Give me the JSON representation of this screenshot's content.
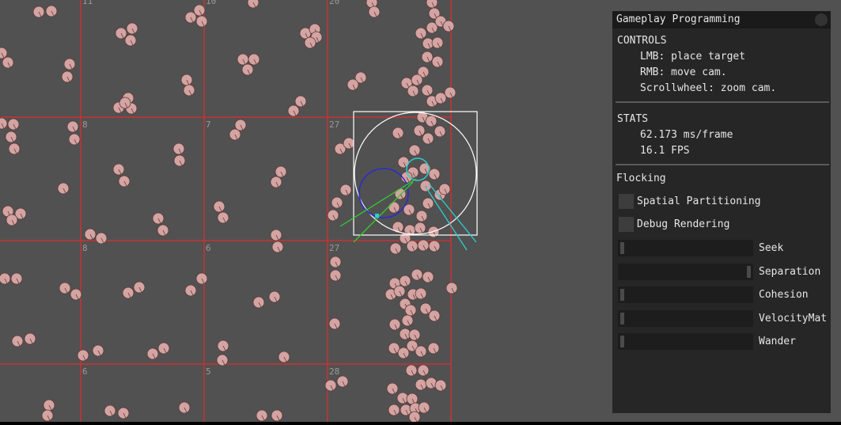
{
  "window": {
    "title": "Gameplay Programming"
  },
  "controls": {
    "header": "CONTROLS",
    "items": [
      "LMB: place target",
      "RMB: move cam.",
      "Scrollwheel: zoom cam."
    ]
  },
  "stats": {
    "header": "STATS",
    "frame_time": "62.173 ms/frame",
    "fps": "16.1 FPS"
  },
  "flocking": {
    "header": "Flocking",
    "toggles": [
      {
        "label": "Spatial Partitioning",
        "checked": false
      },
      {
        "label": "Debug Rendering",
        "checked": false
      }
    ],
    "weights": [
      {
        "label": "Seek",
        "value": 0.0
      },
      {
        "label": "Separation",
        "value": 1.0
      },
      {
        "label": "Cohesion",
        "value": 0.0
      },
      {
        "label": "VelocityMat",
        "value": 0.0
      },
      {
        "label": "Wander",
        "value": 0.0
      }
    ]
  },
  "grid": {
    "cell_counts": [
      {
        "col": 0,
        "row": 0,
        "label": "11"
      },
      {
        "col": 1,
        "row": 0,
        "label": "10"
      },
      {
        "col": 2,
        "row": 0,
        "label": "20"
      },
      {
        "col": 0,
        "row": 1,
        "label": "8"
      },
      {
        "col": 1,
        "row": 1,
        "label": "7"
      },
      {
        "col": 2,
        "row": 1,
        "label": "27"
      },
      {
        "col": 0,
        "row": 2,
        "label": "8"
      },
      {
        "col": 1,
        "row": 2,
        "label": "6"
      },
      {
        "col": 2,
        "row": 2,
        "label": "27"
      },
      {
        "col": 0,
        "row": 3,
        "label": "6"
      },
      {
        "col": 1,
        "row": 3,
        "label": "5"
      },
      {
        "col": 2,
        "row": 3,
        "label": "28"
      }
    ]
  },
  "colors": {
    "background": "#515151",
    "grid_line": "#c83232",
    "agent_fill": "#d4a4a2",
    "agent_stroke": "#5a3a3a",
    "debug_box": "#ffffff",
    "debug_circle_blue": "#2b2bd0",
    "debug_line_green": "#33cc33",
    "debug_line_cyan": "#2ad0d0"
  }
}
